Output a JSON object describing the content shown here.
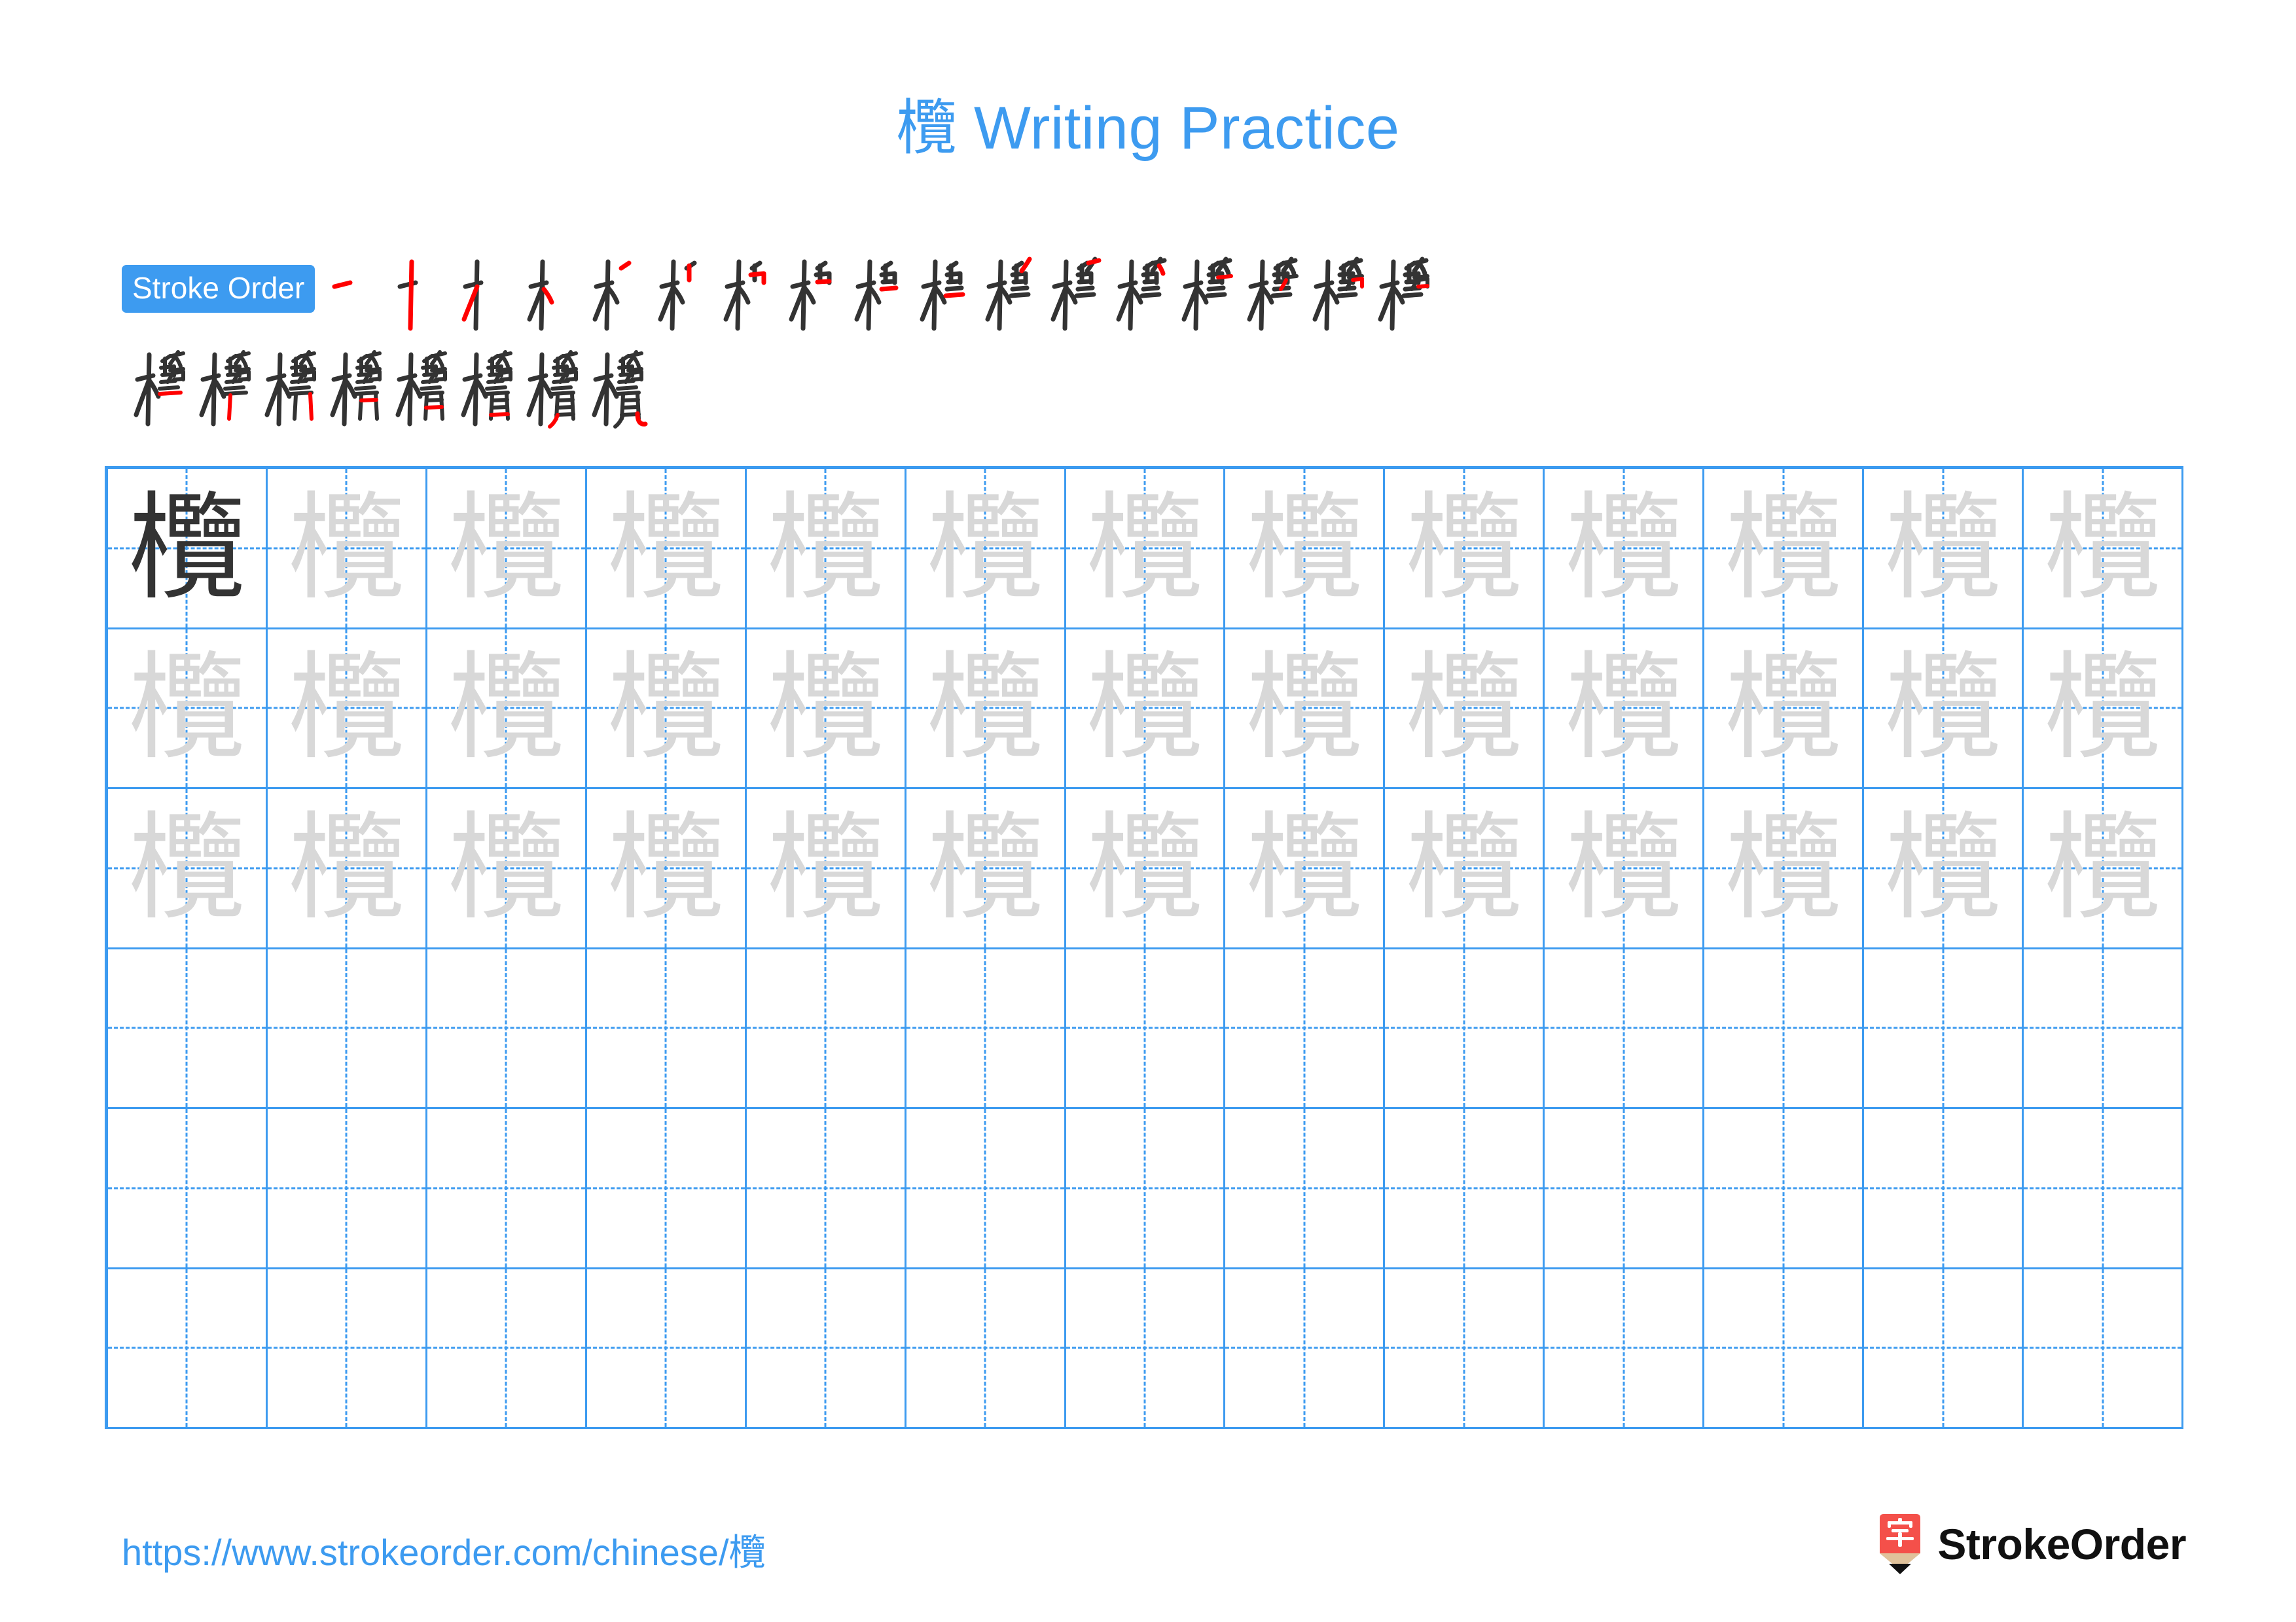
{
  "page": {
    "character": "欖",
    "background_color": "#ffffff",
    "accent_color": "#3d9bf0",
    "stroke_highlight_color": "#ff0000",
    "stroke_ink_color": "#333333",
    "trace_color": "#d8d8d8"
  },
  "header": {
    "title_character": "欖",
    "title_text": " Writing Practice",
    "title_full": "欖 Writing Practice"
  },
  "stroke_order": {
    "badge_label": "Stroke Order",
    "total_strokes": 25,
    "row1_count": 17,
    "row2_count": 8,
    "steps": [
      {
        "index": 1,
        "glyph": "一"
      },
      {
        "index": 2,
        "glyph": "丨"
      },
      {
        "index": 3,
        "glyph": "丿"
      },
      {
        "index": 4,
        "glyph": "丶"
      },
      {
        "index": 5,
        "glyph": "丶"
      },
      {
        "index": 6,
        "glyph": "丨"
      },
      {
        "index": 7,
        "glyph": "𠃍"
      },
      {
        "index": 8,
        "glyph": "一"
      },
      {
        "index": 9,
        "glyph": "一"
      },
      {
        "index": 10,
        "glyph": "一"
      },
      {
        "index": 11,
        "glyph": "丿"
      },
      {
        "index": 12,
        "glyph": "一"
      },
      {
        "index": 13,
        "glyph": "丶"
      },
      {
        "index": 14,
        "glyph": "一"
      },
      {
        "index": 15,
        "glyph": "丿"
      },
      {
        "index": 16,
        "glyph": "𠃍"
      },
      {
        "index": 17,
        "glyph": "一"
      },
      {
        "index": 18,
        "glyph": "一"
      },
      {
        "index": 19,
        "glyph": "丨"
      },
      {
        "index": 20,
        "glyph": "𠃍"
      },
      {
        "index": 21,
        "glyph": "一"
      },
      {
        "index": 22,
        "glyph": "一"
      },
      {
        "index": 23,
        "glyph": "一"
      },
      {
        "index": 24,
        "glyph": "丿"
      },
      {
        "index": 25,
        "glyph": "乚"
      }
    ]
  },
  "practice_grid": {
    "columns": 13,
    "rows": 6,
    "rows_data": [
      {
        "row": 1,
        "cells": [
          "dark",
          "light",
          "light",
          "light",
          "light",
          "light",
          "light",
          "light",
          "light",
          "light",
          "light",
          "light",
          "light"
        ]
      },
      {
        "row": 2,
        "cells": [
          "light",
          "light",
          "light",
          "light",
          "light",
          "light",
          "light",
          "light",
          "light",
          "light",
          "light",
          "light",
          "light"
        ]
      },
      {
        "row": 3,
        "cells": [
          "light",
          "light",
          "light",
          "light",
          "light",
          "light",
          "light",
          "light",
          "light",
          "light",
          "light",
          "light",
          "light"
        ]
      },
      {
        "row": 4,
        "cells": [
          "empty",
          "empty",
          "empty",
          "empty",
          "empty",
          "empty",
          "empty",
          "empty",
          "empty",
          "empty",
          "empty",
          "empty",
          "empty"
        ]
      },
      {
        "row": 5,
        "cells": [
          "empty",
          "empty",
          "empty",
          "empty",
          "empty",
          "empty",
          "empty",
          "empty",
          "empty",
          "empty",
          "empty",
          "empty",
          "empty"
        ]
      },
      {
        "row": 6,
        "cells": [
          "empty",
          "empty",
          "empty",
          "empty",
          "empty",
          "empty",
          "empty",
          "empty",
          "empty",
          "empty",
          "empty",
          "empty",
          "empty"
        ]
      }
    ]
  },
  "footer": {
    "url": "https://www.strokeorder.com/chinese/欖",
    "brand_name": "StrokeOrder",
    "logo_character": "字",
    "logo_body_color": "#f4504a",
    "logo_wood_color": "#e0c29b"
  }
}
